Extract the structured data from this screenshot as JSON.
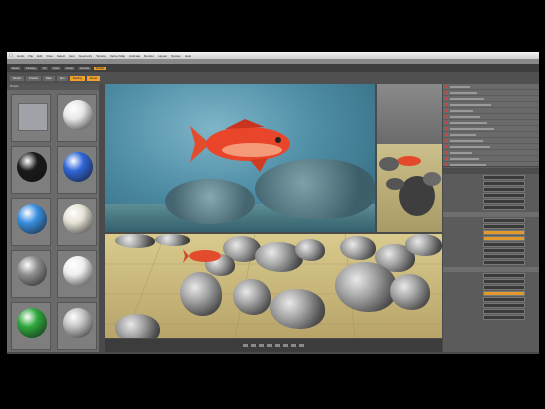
{
  "menubar": {
    "items": [
      "modo",
      "File",
      "Edit",
      "View",
      "Select",
      "Item",
      "Geometry",
      "Texture",
      "Vertex Map",
      "Animate",
      "Render",
      "Layout",
      "System",
      "Help"
    ]
  },
  "titlebar": {
    "title": ""
  },
  "toolbar_tabs": [
    "Model",
    "Topology",
    "UV",
    "Paint",
    "Sculpt",
    "Animate",
    "Render"
  ],
  "toolbar_active_index": 6,
  "toolbar_buttons": [
    "Render",
    "Preview",
    "Bake",
    "Item",
    "Shading",
    "Preset"
  ],
  "presets": {
    "header": "Presets",
    "materials": [
      {
        "name": "preview",
        "color": "#9fa3a8"
      },
      {
        "name": "white-glossy",
        "color": "#e8e8e8"
      },
      {
        "name": "black-glossy",
        "color": "#1a1a1a"
      },
      {
        "name": "blue-glossy",
        "color": "#2f66d8"
      },
      {
        "name": "light-blue",
        "color": "#3a8fe0"
      },
      {
        "name": "cream",
        "color": "#e6e2d6"
      },
      {
        "name": "grey",
        "color": "#8f8f8f"
      },
      {
        "name": "white-matte",
        "color": "#efefef"
      },
      {
        "name": "green",
        "color": "#2fa83c"
      },
      {
        "name": "silver",
        "color": "#c4c4c4"
      }
    ]
  },
  "viewports": {
    "top_label": "",
    "fish_color": "#e8452a"
  },
  "item_list_rows": 14,
  "properties": {
    "tabs": [
      "",
      "",
      "",
      ""
    ],
    "rows": 22
  },
  "colors": {
    "accent": "#e39a2d",
    "panel": "#5b5b5b",
    "water": "#4f8ea6",
    "sand": "#d0c083"
  }
}
